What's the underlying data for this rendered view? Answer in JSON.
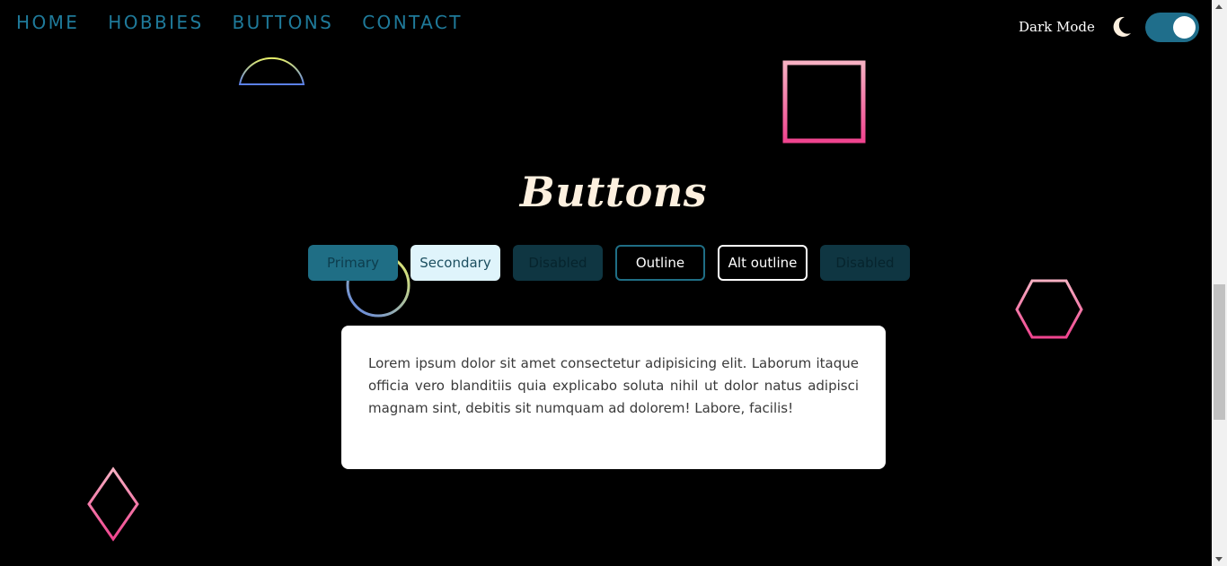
{
  "nav": {
    "items": [
      {
        "label": "HOME"
      },
      {
        "label": "HOBBIES"
      },
      {
        "label": "BUTTONS"
      },
      {
        "label": "CONTACT"
      }
    ]
  },
  "theme": {
    "label": "Dark Mode",
    "enabled": true,
    "icon": "moon-icon",
    "accent": "#1f6e8b"
  },
  "heading": "Buttons",
  "buttons": [
    {
      "label": "Primary",
      "variant": "primary"
    },
    {
      "label": "Secondary",
      "variant": "secondary"
    },
    {
      "label": "Disabled",
      "variant": "disabled"
    },
    {
      "label": "Outline",
      "variant": "outline"
    },
    {
      "label": "Alt outline",
      "variant": "alt-outline"
    },
    {
      "label": "Disabled",
      "variant": "disabled"
    }
  ],
  "card": {
    "text": "Lorem ipsum dolor sit amet consectetur adipisicing elit. Laborum itaque officia vero blanditiis quia explicabo soluta nihil ut dolor natus adipisci magnam sint, debitis sit numquam ad dolorem! Labore, facilis!"
  },
  "colors": {
    "background": "#000000",
    "nav_link": "#1f7a9a",
    "heading": "#fdf0df",
    "shape_pink": "#f0448f",
    "shape_yellow": "#e8f06a",
    "shape_blue": "#5a7fe8"
  }
}
